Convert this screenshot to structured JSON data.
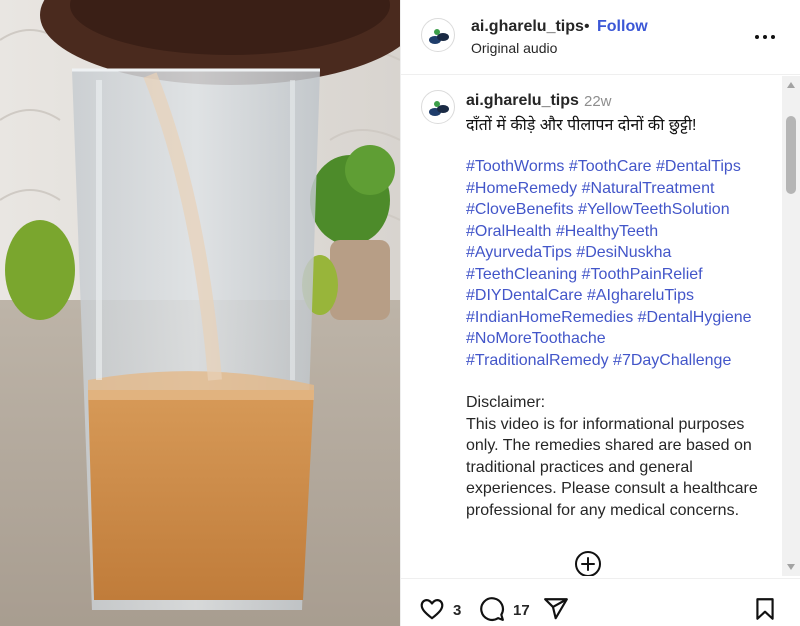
{
  "post": {
    "username": "ai.gharelu_tips",
    "separator": "•",
    "follow_label": "Follow",
    "audio": "Original audio",
    "more_icon": "more-horizontal-icon"
  },
  "caption": {
    "username": "ai.gharelu_tips",
    "time": "22w",
    "title": "दाँतों में कीड़े और पीलापन दोनों की छुट्टी!",
    "hashtags": [
      "#ToothWorms",
      "#ToothCare",
      "#DentalTips",
      "#HomeRemedy",
      "#NaturalTreatment",
      "#CloveBenefits",
      "#YellowTeethSolution",
      "#OralHealth",
      "#HealthyTeeth",
      "#AyurvedaTips",
      "#DesiNuskha",
      "#TeethCleaning",
      "#ToothPainRelief",
      "#DIYDentalCare",
      "#AIghareluTips",
      "#IndianHomeRemedies",
      "#DentalHygiene",
      "#NoMoreToothache",
      "#TraditionalRemedy",
      "#7DayChallenge"
    ],
    "disclaimer_title": "Disclaimer:",
    "disclaimer_text": "This video is for informational purposes only. The remedies shared are based on traditional practices and general experiences. Please consult a healthcare professional for any medical concerns."
  },
  "actions": {
    "likes": "3",
    "comments": "17"
  },
  "colors": {
    "link": "#4356c9",
    "follow": "#3b57d6",
    "muted": "#8e8e8e"
  }
}
